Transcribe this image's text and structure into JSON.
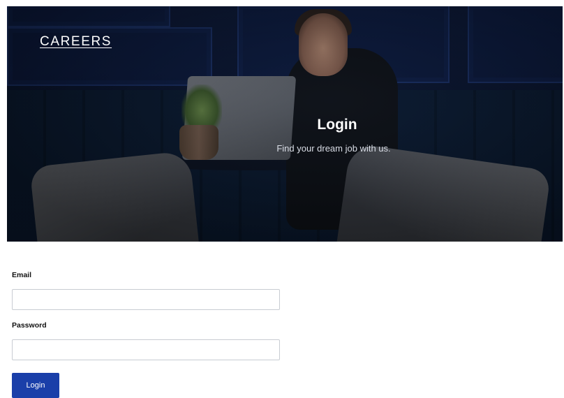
{
  "header": {
    "brand": "CAREERS"
  },
  "hero": {
    "title": "Login",
    "subtitle": "Find your dream job with us."
  },
  "form": {
    "email_label": "Email",
    "email_value": "",
    "password_label": "Password",
    "password_value": "",
    "submit_label": "Login"
  },
  "colors": {
    "button_bg": "#1a3fa9",
    "hero_bg": "#0a1530"
  }
}
